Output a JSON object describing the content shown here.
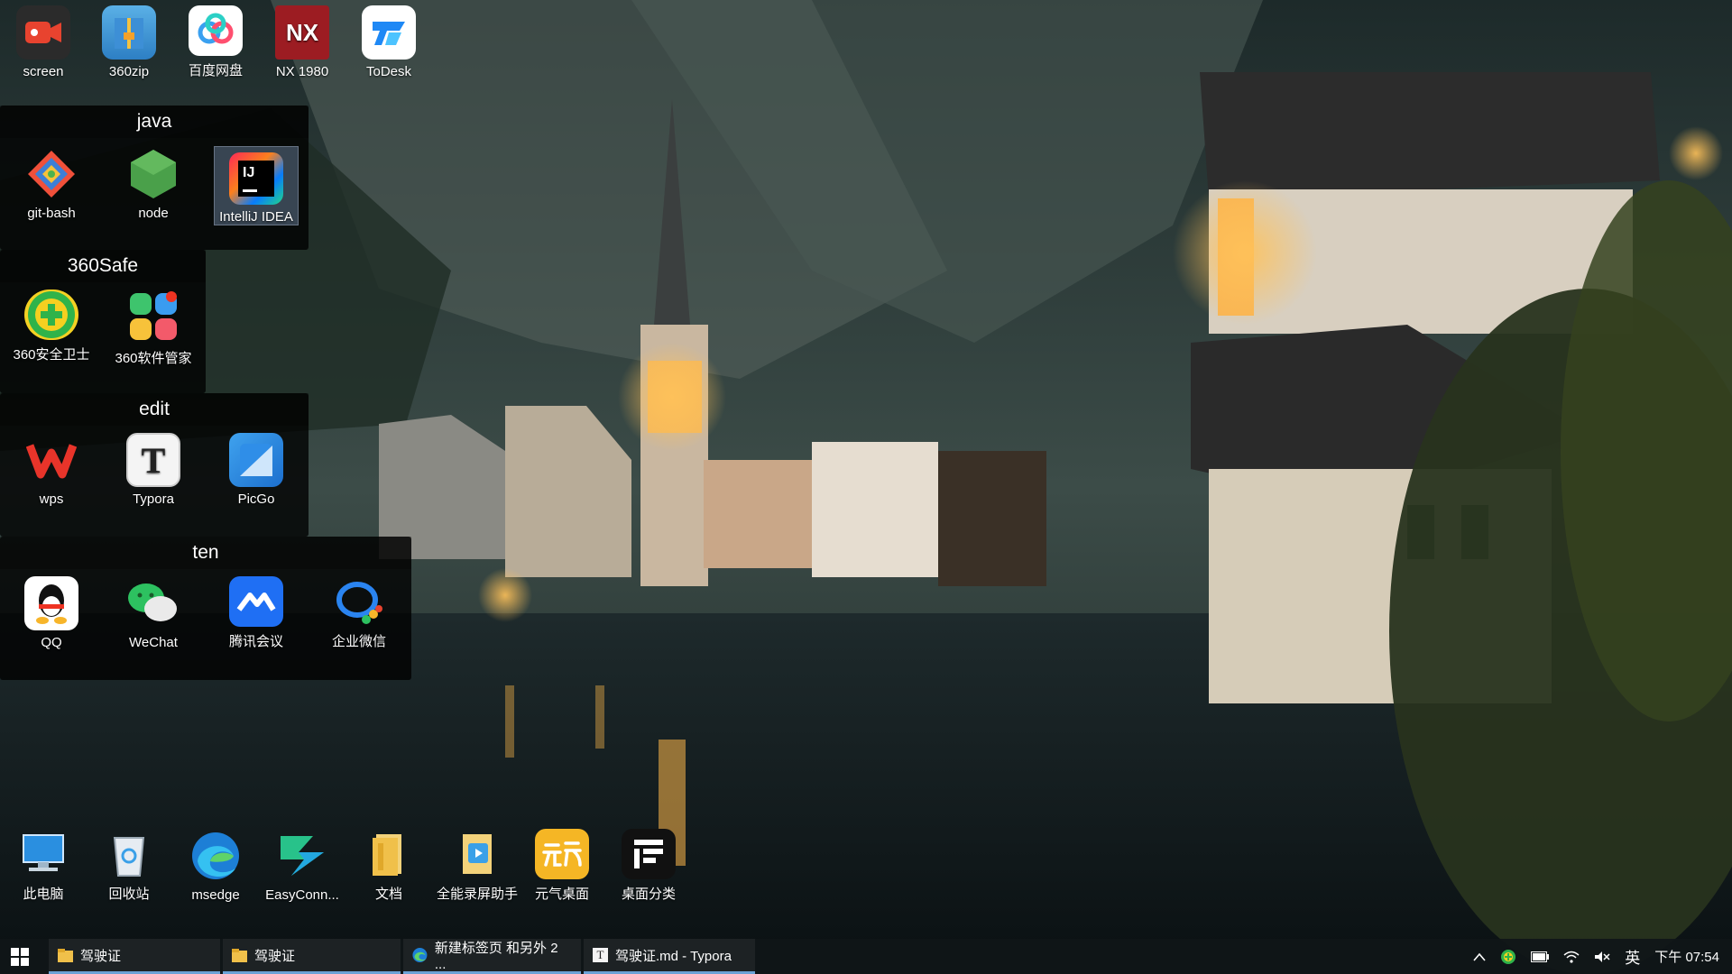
{
  "desktop_top_icons": [
    {
      "label": "screen",
      "icon": "screen-recorder-icon"
    },
    {
      "label": "360zip",
      "icon": "360zip-icon"
    },
    {
      "label": "百度网盘",
      "icon": "baidu-netdisk-icon"
    },
    {
      "label": "NX 1980",
      "icon": "nx-icon"
    },
    {
      "label": "ToDesk",
      "icon": "todesk-icon"
    }
  ],
  "fences": [
    {
      "title": "java",
      "items": [
        {
          "label": "git-bash",
          "icon": "git-bash-icon"
        },
        {
          "label": "node",
          "icon": "node-icon"
        },
        {
          "label": "IntelliJ IDEA",
          "icon": "intellij-icon"
        }
      ]
    },
    {
      "title": "360Safe",
      "items": [
        {
          "label": "360安全卫士",
          "icon": "360-security-icon"
        },
        {
          "label": "360软件管家",
          "icon": "360-software-manager-icon"
        }
      ]
    },
    {
      "title": "edit",
      "items": [
        {
          "label": "wps",
          "icon": "wps-icon"
        },
        {
          "label": "Typora",
          "icon": "typora-icon"
        },
        {
          "label": "PicGo",
          "icon": "picgo-icon"
        }
      ]
    },
    {
      "title": "ten",
      "items": [
        {
          "label": "QQ",
          "icon": "qq-icon"
        },
        {
          "label": "WeChat",
          "icon": "wechat-icon"
        },
        {
          "label": "腾讯会议",
          "icon": "tencent-meeting-icon"
        },
        {
          "label": "企业微信",
          "icon": "wecom-icon"
        }
      ]
    }
  ],
  "desktop_bottom_icons": [
    {
      "label": "此电脑",
      "icon": "this-pc-icon"
    },
    {
      "label": "回收站",
      "icon": "recycle-bin-icon"
    },
    {
      "label": "msedge",
      "icon": "edge-icon"
    },
    {
      "label": "EasyConn...",
      "icon": "easyconnect-icon"
    },
    {
      "label": "文档",
      "icon": "folder-icon"
    },
    {
      "label": "全能录屏助手",
      "icon": "screen-record-helper-icon"
    },
    {
      "label": "元气桌面",
      "icon": "yuanqi-desktop-icon"
    },
    {
      "label": "桌面分类",
      "icon": "desktop-classify-icon"
    }
  ],
  "taskbar": {
    "items": [
      {
        "label": "驾驶证",
        "icon": "folder-icon"
      },
      {
        "label": "驾驶证",
        "icon": "folder-icon"
      },
      {
        "label": "新建标签页 和另外 2 ...",
        "icon": "edge-icon"
      },
      {
        "label": "驾驶证.md - Typora",
        "icon": "typora-icon"
      }
    ],
    "tray": {
      "ime": "英",
      "clock": "下午 07:54"
    }
  },
  "colors": {
    "taskbar_bg": "#101618",
    "active_underline": "#6aa2d6",
    "fence_bg": "#000000"
  }
}
